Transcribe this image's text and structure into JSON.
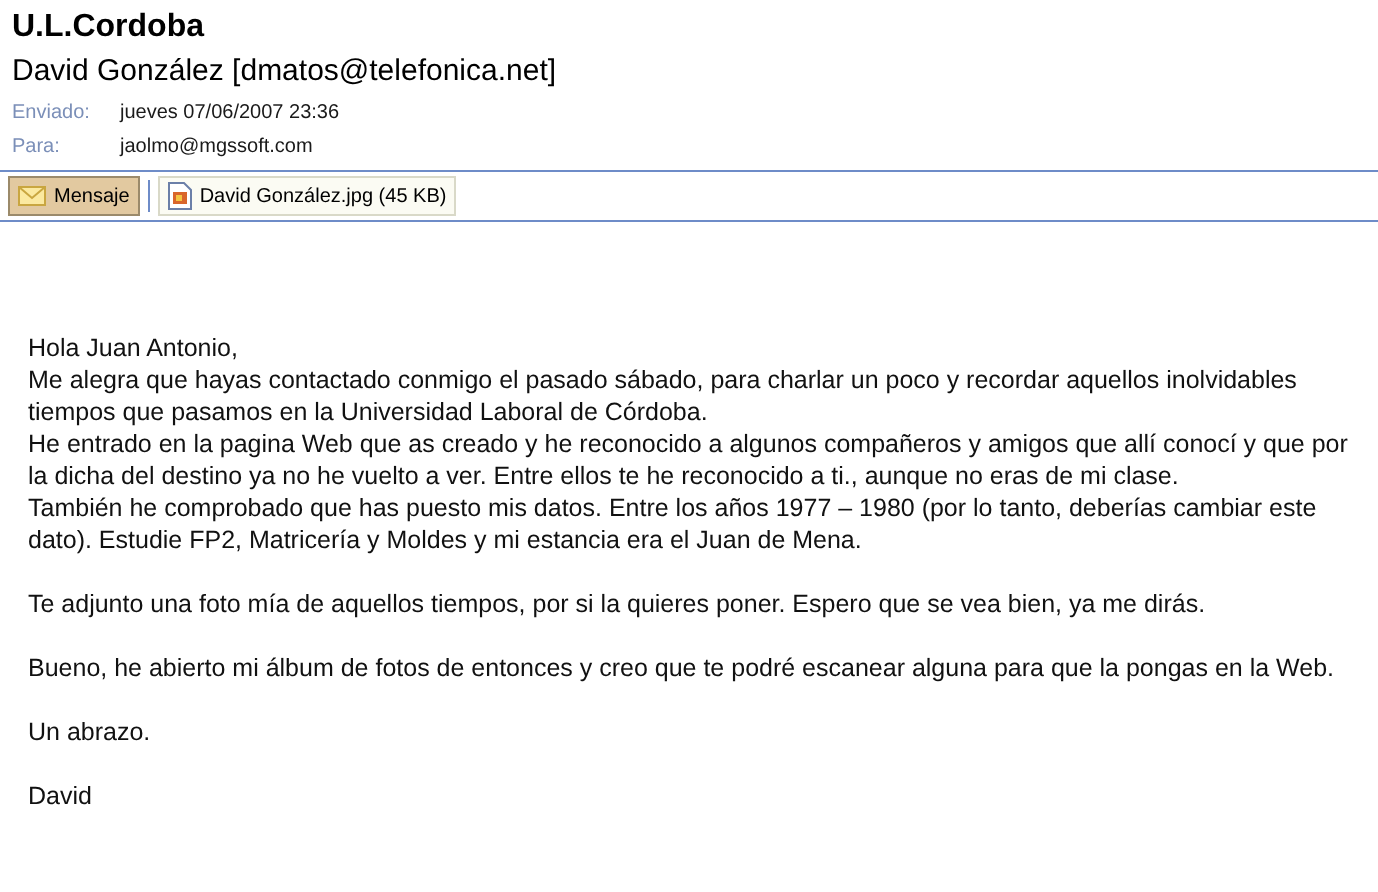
{
  "subject": "U.L.Cordoba",
  "sender": "David González [dmatos@telefonica.net]",
  "fields": [
    {
      "label": "Enviado:",
      "value": "jueves 07/06/2007 23:36"
    },
    {
      "label": "Para:",
      "value": "jaolmo@mgssoft.com"
    }
  ],
  "tabs": [
    {
      "kind": "message",
      "label": "Mensaje",
      "selected": true
    },
    {
      "kind": "attachment",
      "label": "David González.jpg (45 KB)",
      "selected": false
    }
  ],
  "body": [
    [
      "Hola Juan Antonio,",
      "Me alegra que hayas contactado conmigo el pasado sábado, para charlar un poco y recordar aquellos inolvidables tiempos que pasamos en la Universidad Laboral de Córdoba.",
      "He entrado en la pagina Web que as creado y he reconocido a algunos compañeros y amigos que allí conocí y que por la dicha del destino ya no he vuelto a ver. Entre ellos te he reconocido a ti.,  aunque no eras de mi clase.",
      "También he comprobado que has puesto mis datos. Entre los años 1977 – 1980 (por lo tanto, deberías cambiar este dato). Estudie FP2, Matricería y Moldes y mi estancia era el Juan de Mena."
    ],
    [
      "Te adjunto una foto mía de aquellos tiempos, por si la quieres poner. Espero que se vea bien, ya me dirás."
    ],
    [
      "Bueno, he abierto mi álbum de fotos de entonces y creo que te podré escanear alguna para que la pongas en la Web."
    ],
    [
      "Un abrazo."
    ],
    [
      "David"
    ]
  ]
}
